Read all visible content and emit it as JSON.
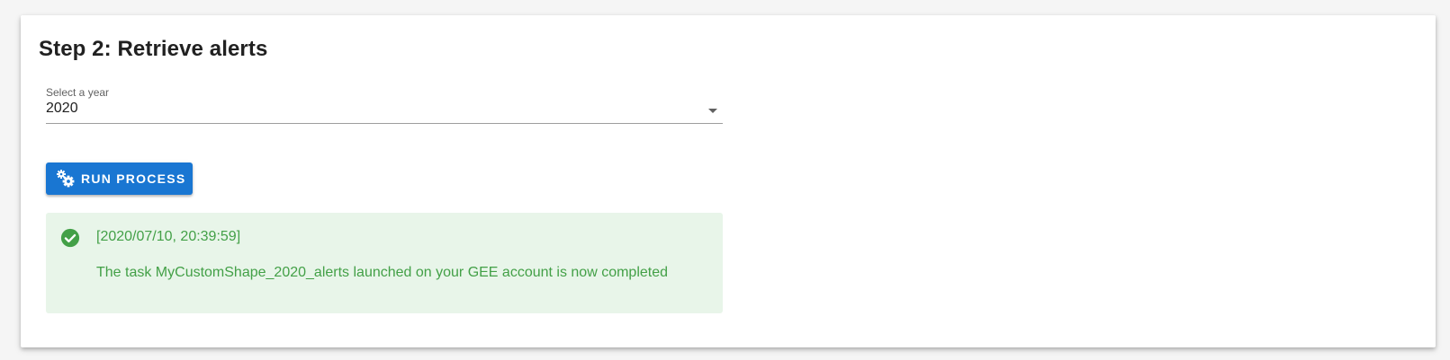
{
  "card": {
    "title": "Step 2: Retrieve alerts"
  },
  "year_select": {
    "label": "Select a year",
    "value": "2020"
  },
  "run_button": {
    "label": "RUN PROCESS",
    "icon": "cogs-icon"
  },
  "alert": {
    "status": "success",
    "icon": "check-circle-icon",
    "timestamp": "[2020/07/10, 20:39:59]",
    "message": "The task MyCustomShape_2020_alerts launched on your GEE account is now completed"
  },
  "colors": {
    "primary": "#1976d2",
    "success_text": "#43a047",
    "success_background": "#e8f5e9"
  }
}
